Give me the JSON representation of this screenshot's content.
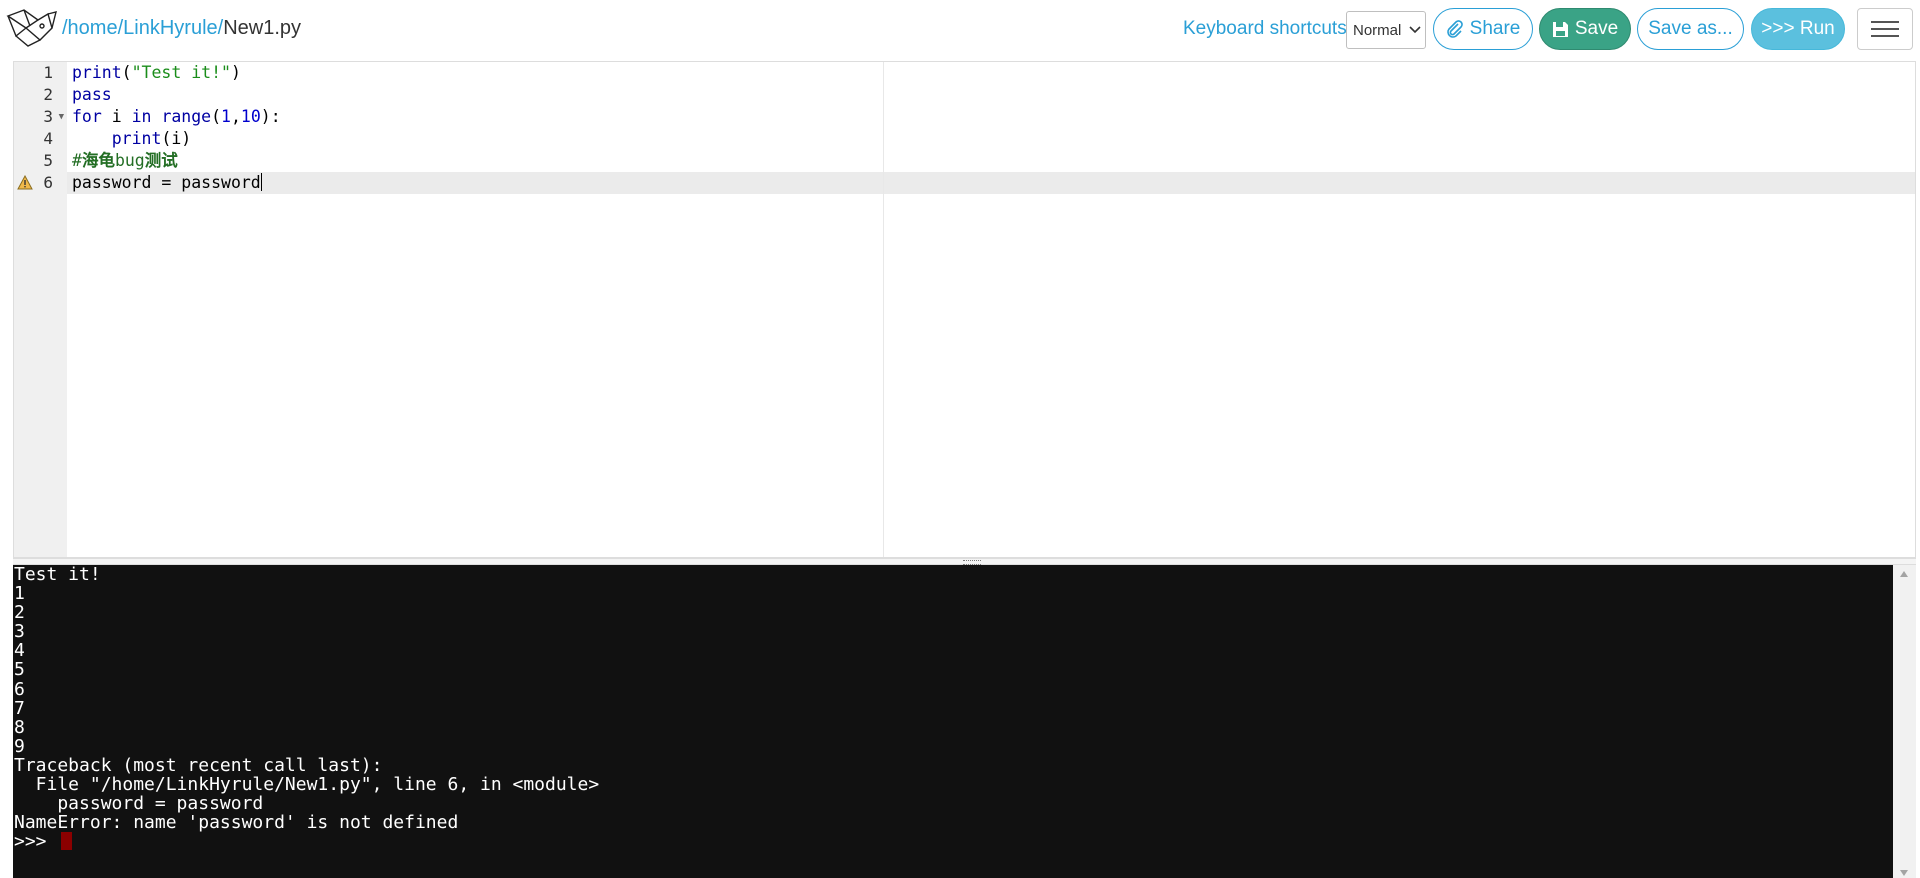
{
  "header": {
    "path_home": "/home",
    "path_user": "LinkHyrule",
    "path_sep": "/",
    "file_name": "New1.py",
    "keyboard_label": "Keyboard shortcuts:",
    "keyboard_mode": "Normal",
    "share_label": "Share",
    "save_label": "Save",
    "save_as_label": "Save as...",
    "run_label": ">>> Run",
    "icons": {
      "logo": "pythonanywhere-logo",
      "share": "paperclip-icon",
      "save": "floppy-disk-icon",
      "menu": "hamburger-menu-icon",
      "dropdown": "chevron-down-icon",
      "warning": "warning-icon"
    }
  },
  "editor": {
    "line_numbers": [
      "1",
      "2",
      "3",
      "4",
      "5",
      "6"
    ],
    "lines": [
      {
        "text": "print(\"Test it!\")"
      },
      {
        "text": "pass"
      },
      {
        "text": "for i in range(1,10):"
      },
      {
        "text": "    print(i)"
      },
      {
        "text": "#海龟bug测试"
      },
      {
        "text": "password = password"
      }
    ],
    "tokens": {
      "l1_fn": "print",
      "l1_p1": "(",
      "l1_str": "\"Test it!\"",
      "l1_p2": ")",
      "l2_kw": "pass",
      "l3_kw1": "for",
      "l3_sp1": " i ",
      "l3_kw2": "in",
      "l3_sp2": " ",
      "l3_fn": "range",
      "l3_p1": "(",
      "l3_n1": "1",
      "l3_c": ",",
      "l3_n2": "10",
      "l3_p2": "):",
      "l4_ind": "    ",
      "l4_fn": "print",
      "l4_rest": "(i)",
      "l5_hash": "#",
      "l5_cjk1": "海龟",
      "l5_bug": "bug",
      "l5_cjk2": "测试",
      "l6_text": "password = password"
    }
  },
  "console": {
    "output": "Test it!\n1\n2\n3\n4\n5\n6\n7\n8\n9\nTraceback (most recent call last):\n  File \"/home/LinkHyrule/New1.py\", line 6, in <module>\n    password = password\nNameError: name 'password' is not defined",
    "prompt": ">>> "
  },
  "colors": {
    "accent": "#2a9fd6",
    "save_green": "#3aa386",
    "run_blue": "#5bc0de",
    "console_bg": "#111111",
    "cursor_red": "#8b0000"
  }
}
